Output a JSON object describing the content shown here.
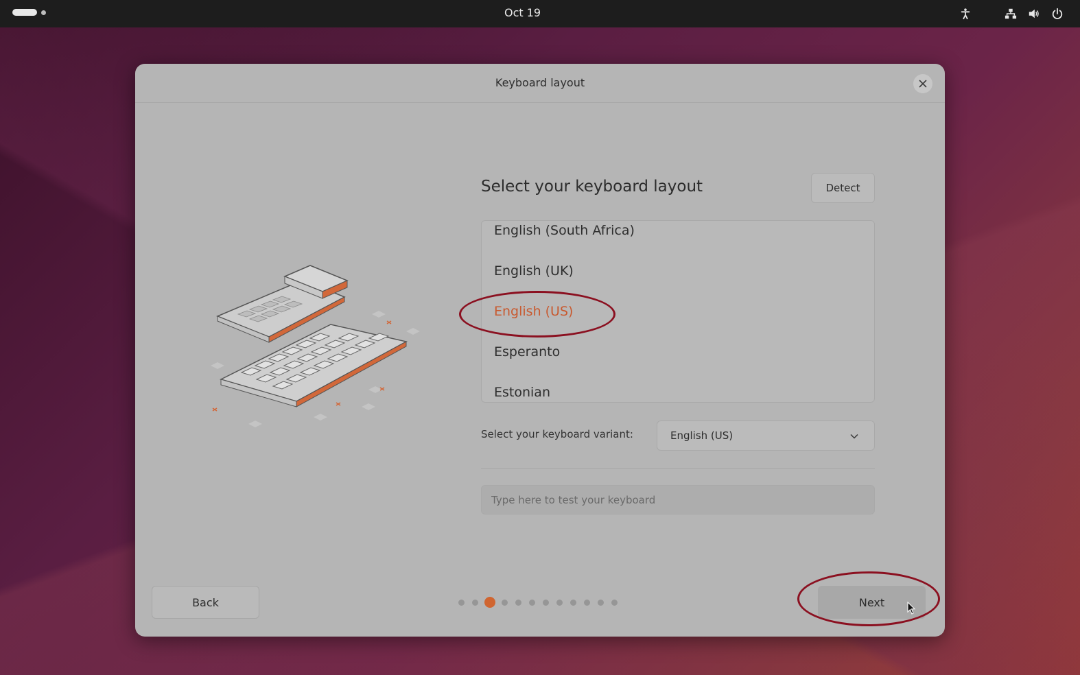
{
  "topbar": {
    "date": "Oct 19",
    "icons": [
      "accessibility-icon",
      "network-icon",
      "volume-icon",
      "power-icon"
    ]
  },
  "dialog": {
    "title": "Keyboard layout",
    "heading": "Select your keyboard layout",
    "detect_label": "Detect",
    "layouts": [
      "English (South Africa)",
      "English (UK)",
      "English (US)",
      "Esperanto",
      "Estonian"
    ],
    "selected_layout": "English (US)",
    "variant_label": "Select your keyboard variant:",
    "variant_value": "English (US)",
    "test_placeholder": "Type here to test your keyboard",
    "back_label": "Back",
    "next_label": "Next",
    "pager": {
      "total": 12,
      "current": 3
    }
  },
  "colors": {
    "accent": "#d06530",
    "annotation": "#8b1020"
  }
}
